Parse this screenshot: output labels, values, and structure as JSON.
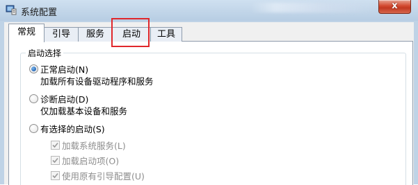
{
  "window": {
    "title": "系统配置",
    "close_symbol": "x"
  },
  "tabs": [
    {
      "label": "常规",
      "active": true
    },
    {
      "label": "引导",
      "active": false
    },
    {
      "label": "服务",
      "active": false
    },
    {
      "label": "启动",
      "active": false
    },
    {
      "label": "工具",
      "active": false
    }
  ],
  "startup_selection": {
    "group_title": "启动选择",
    "options": [
      {
        "label": "正常启动(N)",
        "description": "加载所有设备驱动程序和服务",
        "selected": true
      },
      {
        "label": "诊断启动(D)",
        "description": "仅加载基本设备和服务",
        "selected": false
      },
      {
        "label": "有选择的启动(S)",
        "selected": false
      }
    ],
    "selective_items": [
      {
        "label": "加载系统服务(L)",
        "checked": true,
        "enabled": false
      },
      {
        "label": "加载启动项(O)",
        "checked": true,
        "enabled": false
      },
      {
        "label": "使用原有引导配置(U)",
        "checked": true,
        "enabled": false
      }
    ]
  },
  "annotation": {
    "highlight_color": "#e0272b",
    "highlighted_tab": "启动"
  },
  "colors": {
    "close_button": "#c8412a",
    "radio_dot": "#1f5fb0"
  }
}
